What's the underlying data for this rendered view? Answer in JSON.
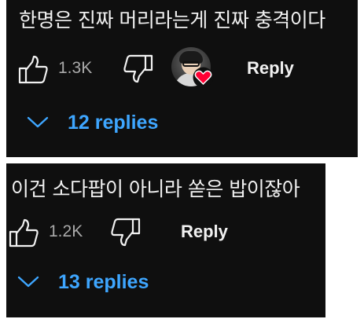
{
  "comments": [
    {
      "text": "한명은 진짜 머리라는게 진짜 충격이다",
      "like_count": "1.3K",
      "reply_label": "Reply",
      "replies_label": "12 replies",
      "has_creator_heart": true
    },
    {
      "text": "이건 소다팝이 아니라 쏟은 밥이잖아",
      "like_count": "1.2K",
      "reply_label": "Reply",
      "replies_label": "13 replies",
      "has_creator_heart": false
    }
  ],
  "colors": {
    "background": "#0f0f0f",
    "text": "#f1f1f1",
    "muted": "#aaaaaa",
    "link": "#3ea6ff",
    "heart": "#ff0033"
  },
  "icons": {
    "like": "thumbs-up-icon",
    "dislike": "thumbs-down-icon",
    "expand": "chevron-down-icon",
    "creator_heart": "heart-icon"
  }
}
